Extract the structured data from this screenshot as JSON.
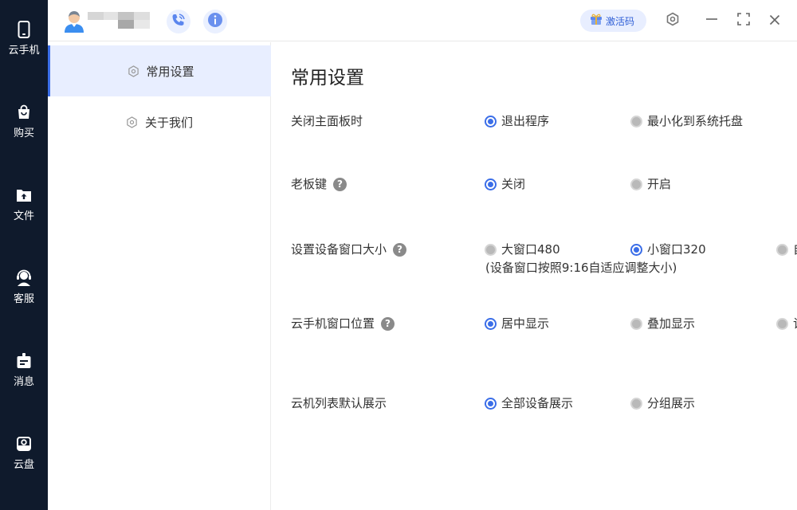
{
  "nav": {
    "items": [
      {
        "label": "云手机",
        "icon": "phone-icon"
      },
      {
        "label": "购买",
        "icon": "shopping-bag-icon"
      },
      {
        "label": "文件",
        "icon": "file-upload-icon"
      },
      {
        "label": "客服",
        "icon": "customer-service-icon"
      },
      {
        "label": "消息",
        "icon": "message-icon"
      },
      {
        "label": "云盘",
        "icon": "cloud-disk-icon"
      }
    ]
  },
  "topbar": {
    "activate_label": "激活码",
    "icons": [
      "user-avatar-icon",
      "phone-call-icon",
      "info-icon",
      "gift-icon",
      "settings-icon",
      "minimize-icon",
      "fullscreen-icon",
      "close-icon"
    ]
  },
  "sidebar": {
    "items": [
      {
        "label": "常用设置",
        "active": true
      },
      {
        "label": "关于我们",
        "active": false
      }
    ]
  },
  "main": {
    "title": "常用设置",
    "settings": [
      {
        "label": "关闭主面板时",
        "help": false,
        "options": [
          {
            "label": "退出程序",
            "selected": true
          },
          {
            "label": "最小化到系统托盘",
            "selected": false
          }
        ]
      },
      {
        "label": "老板键",
        "help": true,
        "options": [
          {
            "label": "关闭",
            "selected": true
          },
          {
            "label": "开启",
            "selected": false
          }
        ]
      },
      {
        "label": "设置设备窗口大小",
        "help": true,
        "options": [
          {
            "label": "大窗口480",
            "selected": false
          },
          {
            "label": "小窗口320",
            "selected": true
          },
          {
            "label": "自",
            "selected": false
          }
        ],
        "note": "(设备窗口按照9:16自适应调整大小)"
      },
      {
        "label": "云手机窗口位置",
        "help": true,
        "options": [
          {
            "label": "居中显示",
            "selected": true
          },
          {
            "label": "叠加显示",
            "selected": false
          },
          {
            "label": "记",
            "selected": false
          }
        ]
      },
      {
        "label": "云机列表默认展示",
        "help": false,
        "options": [
          {
            "label": "全部设备展示",
            "selected": true
          },
          {
            "label": "分组展示",
            "selected": false
          }
        ]
      }
    ],
    "help_glyph": "?"
  },
  "colors": {
    "nav_bg": "#0f1a2c",
    "accent": "#3b6ee8",
    "active_bg": "#e8eeff"
  }
}
